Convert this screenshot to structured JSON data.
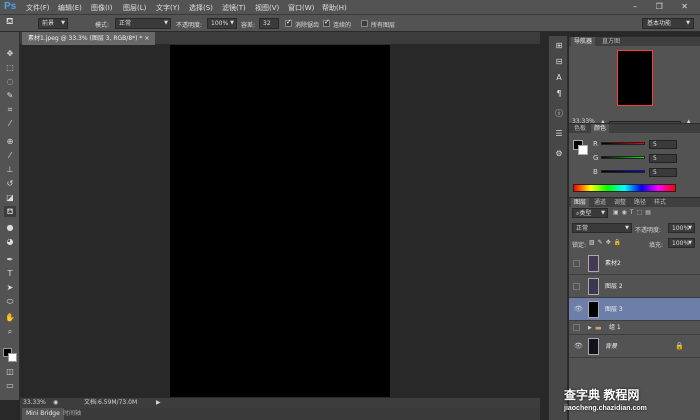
{
  "app": {
    "logo": "Ps"
  },
  "menu": [
    "文件(F)",
    "编辑(E)",
    "图像(I)",
    "图层(L)",
    "文字(Y)",
    "选择(S)",
    "滤镜(T)",
    "视图(V)",
    "窗口(W)",
    "帮助(H)"
  ],
  "window_buttons": "– ❐ ✕",
  "options": {
    "preset": "前景",
    "mode_label": "模式:",
    "mode_value": "正常",
    "opacity_label": "不透明度:",
    "opacity_value": "100%",
    "tolerance_label": "容差:",
    "tolerance_value": "32",
    "antialias": "消除锯齿",
    "contiguous": "连续的",
    "all_layers": "所有图层",
    "workspace": "基本功能"
  },
  "document": {
    "tab_title": "素材1.jpeg @ 33.3% (图层 3, RGB/8*) *",
    "zoom": "33.33%",
    "info": "文档:6.59M/73.0M"
  },
  "bottom_tabs": [
    "Mini Bridge",
    "时间轴"
  ],
  "navigator": {
    "tabs": [
      "导航器",
      "直方图"
    ],
    "zoom": "33.33%"
  },
  "color": {
    "tabs": [
      "色板",
      "颜色"
    ],
    "r_label": "R",
    "g_label": "G",
    "b_label": "B",
    "r": "5",
    "g": "5",
    "b": "5"
  },
  "layers_panel": {
    "tabs": [
      "图层",
      "通道",
      "调整",
      "路径",
      "样式"
    ],
    "filter": "类型",
    "blend": "正常",
    "opacity_label": "不透明度:",
    "opacity": "100%",
    "lock_label": "锁定:",
    "fill_label": "填充:",
    "fill": "100%",
    "layers": [
      {
        "name": "素材2",
        "visible": false,
        "selected": false
      },
      {
        "name": "图层 2",
        "visible": false,
        "selected": false
      },
      {
        "name": "图层 3",
        "visible": true,
        "selected": true
      },
      {
        "name": "组 1",
        "visible": false,
        "selected": false
      },
      {
        "name": "背景",
        "visible": true,
        "selected": false
      }
    ]
  },
  "watermark": {
    "line1": "查字典 教程网",
    "line2": "jiaocheng.chazidian.com"
  }
}
